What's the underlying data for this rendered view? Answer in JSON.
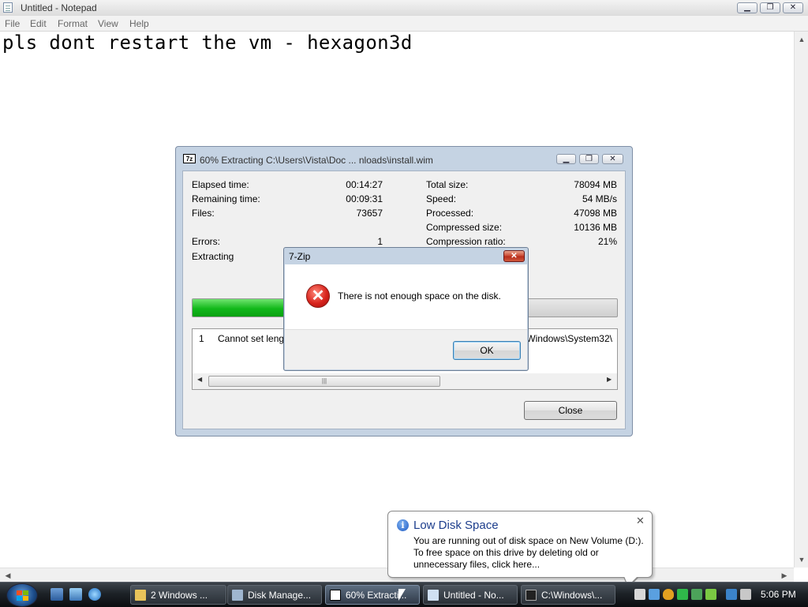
{
  "notepad": {
    "title": "Untitled - Notepad",
    "menu": [
      "File",
      "Edit",
      "Format",
      "View",
      "Help"
    ],
    "content": "pls dont restart the vm - hexagon3d",
    "window_buttons": [
      "minimize-icon",
      "maximize-icon",
      "close-icon"
    ]
  },
  "zip": {
    "app_icon": "7z",
    "title": "60% Extracting C:\\Users\\Vista\\Doc ... nloads\\install.wim",
    "left_labels": [
      "Elapsed time:",
      "Remaining time:",
      "Files:",
      "Errors:",
      "Extracting"
    ],
    "left_values": [
      "00:14:27",
      "00:09:31",
      "73657",
      "1"
    ],
    "right_labels": [
      "Total size:",
      "Speed:",
      "Processed:",
      "Compressed size:",
      "Compression ratio:"
    ],
    "right_values": [
      "78094 MB",
      "54 MB/s",
      "47098 MB",
      "10136 MB",
      "21%"
    ],
    "progress_fraction": 0.6,
    "error_list": {
      "number": "1",
      "message": "Cannot set length",
      "message_tail": "2\\Windows\\System32\\"
    },
    "close_label": "Close"
  },
  "msgbox": {
    "title": "7-Zip",
    "close_glyph": "✕",
    "icon_glyph": "✕",
    "text": "There is not enough space on the disk.",
    "ok_label": "OK"
  },
  "balloon": {
    "title": "Low Disk Space",
    "lines": [
      "You are running out of disk space on New Volume (D:).",
      "To free space on this drive by deleting old or",
      "unnecessary files, click here..."
    ],
    "close_glyph": "✕",
    "icon_glyph": "i"
  },
  "taskbar": {
    "buttons": [
      {
        "label": "2 Windows ...",
        "icon": "folder-icon",
        "color": "#e8c35a"
      },
      {
        "label": "Disk Manage...",
        "icon": "disk-management-icon",
        "color": "#9fb6d0"
      },
      {
        "label": "60% Extracti...",
        "icon": "7zip-icon",
        "color": "#ffffff"
      },
      {
        "label": "Untitled - No...",
        "icon": "notepad-icon",
        "color": "#cfe0f2"
      },
      {
        "label": "C:\\Windows\\...",
        "icon": "cmd-icon",
        "color": "#222222"
      }
    ],
    "clock": "5:06 PM"
  },
  "colors": {
    "progress_green": "#11b81a",
    "balloon_title": "#1c3d8c",
    "error_red": "#d8241d"
  }
}
